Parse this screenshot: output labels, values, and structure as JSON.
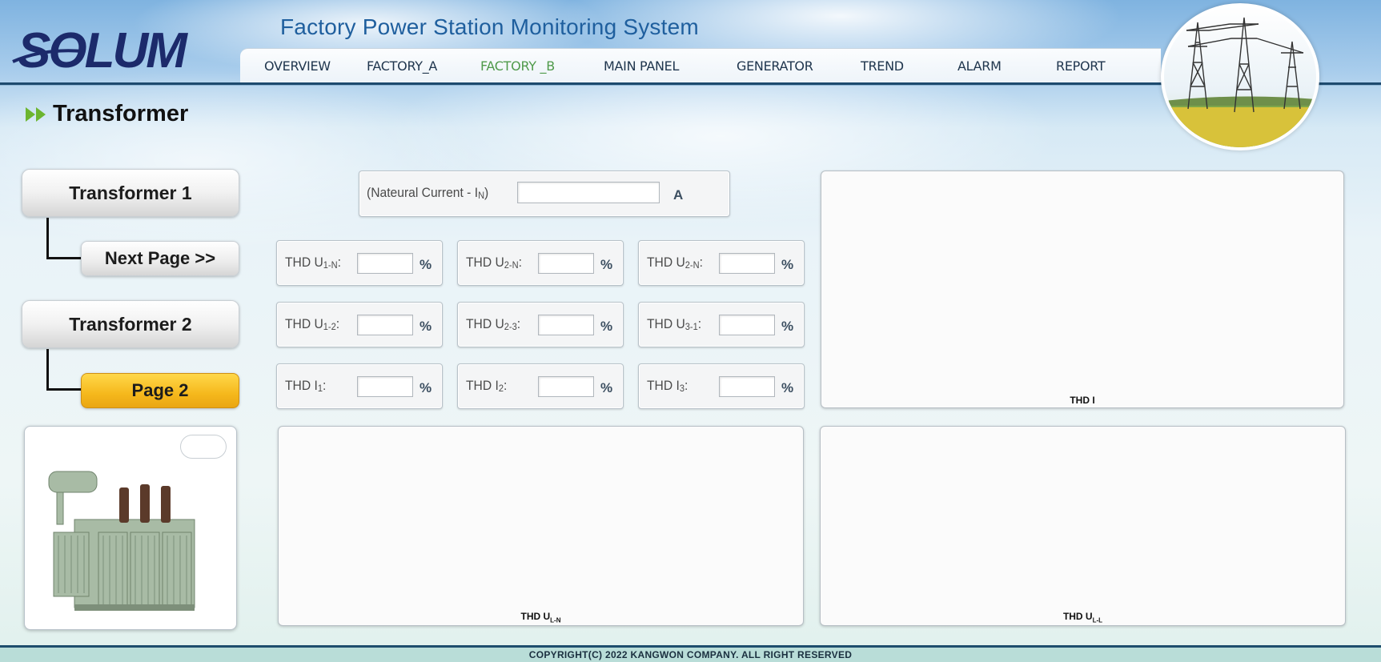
{
  "header": {
    "logo_text": "SOLUM",
    "title": "Factory Power Station Monitoring System",
    "nav": [
      {
        "label": "OVERVIEW",
        "active": false
      },
      {
        "label": "FACTORY_A",
        "active": false
      },
      {
        "label": "FACTORY _B",
        "active": true
      },
      {
        "label": "MAIN PANEL",
        "active": false
      },
      {
        "label": "GENERATOR",
        "active": false
      },
      {
        "label": "TREND",
        "active": false
      },
      {
        "label": "ALARM",
        "active": false
      },
      {
        "label": "REPORT",
        "active": false
      }
    ],
    "photo_icon": "power-tower-photo"
  },
  "page": {
    "title": "Transformer",
    "title_icon": "double-arrow-icon"
  },
  "sidebar": {
    "transformer1": "Transformer 1",
    "next_page": "Next Page >>",
    "transformer2": "Transformer 2",
    "page2": "Page 2",
    "page2_active": true,
    "image": "transformer-image"
  },
  "measurements": {
    "neutral": {
      "label": "(Nateural Current - I",
      "sub": "N",
      "suffix": ")",
      "value": "",
      "unit": "A"
    },
    "thd": [
      {
        "label": "THD U",
        "sub": "1-N",
        "suffix": ":",
        "value": "",
        "unit": "%"
      },
      {
        "label": "THD U",
        "sub": "2-N",
        "suffix": ":",
        "value": "",
        "unit": "%"
      },
      {
        "label": "THD U",
        "sub": "2-N",
        "suffix": ":",
        "value": "",
        "unit": "%"
      },
      {
        "label": "THD U",
        "sub": "1-2",
        "suffix": ":",
        "value": "",
        "unit": "%"
      },
      {
        "label": "THD U",
        "sub": "2-3",
        "suffix": ":",
        "value": "",
        "unit": "%"
      },
      {
        "label": "THD U",
        "sub": "3-1",
        "suffix": ":",
        "value": "",
        "unit": "%"
      },
      {
        "label": "THD I",
        "sub": "1",
        "suffix": ":",
        "value": "",
        "unit": "%"
      },
      {
        "label": "THD I",
        "sub": "2",
        "suffix": ":",
        "value": "",
        "unit": "%"
      },
      {
        "label": "THD I",
        "sub": "3",
        "suffix": ":",
        "value": "",
        "unit": "%"
      }
    ]
  },
  "charts": {
    "thd_i": {
      "label": "THD I"
    },
    "thd_uln": {
      "label": "THD U",
      "sub": "L-N"
    },
    "thd_ull": {
      "label": "THD U",
      "sub": "L-L"
    }
  },
  "footer": {
    "copyright": "COPYRIGHT(C) 2022 KANGWON COMPANY. ALL RIGHT RESERVED"
  },
  "colors": {
    "brand": "#1c2a6b",
    "nav_active": "#4f9a4a",
    "page_button_active": "#f5b81c",
    "header_rule": "#1d4a6e"
  }
}
